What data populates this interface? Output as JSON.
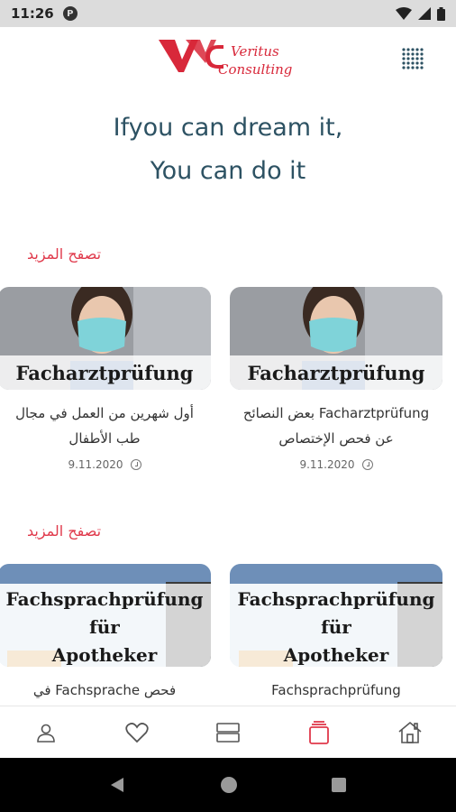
{
  "status_bar": {
    "time": "11:26",
    "app_icon_label": "P",
    "icons": [
      "wifi-icon",
      "signal-icon",
      "battery-icon"
    ]
  },
  "header": {
    "logo_text_line1": "Veritus",
    "logo_text_line2": "Consulting",
    "logo_mark": "VC",
    "menu_icon": "grid-dots-icon"
  },
  "hero": {
    "line1": "Ifyou can dream it,",
    "line2": "You can do it"
  },
  "sections": [
    {
      "more_label": "تصفح المزيد",
      "cards": [
        {
          "image_title": "Facharztprüfung",
          "text": "Facharztprüfung بعض النصائح عن فحص الإختصاص",
          "date": "9.11.2020"
        },
        {
          "image_title": "Facharztprüfung",
          "text": "أول شهرين من العمل في مجال طب الأطفال",
          "date": "9.11.2020"
        }
      ]
    },
    {
      "more_label": "تصفح المزيد",
      "cards": [
        {
          "image_title_lines": [
            "Fachsprachprüfung",
            "für",
            "Apotheker"
          ],
          "text": "Fachsprachprüfung"
        },
        {
          "image_title_lines": [
            "Fachsprachprüfung",
            "für",
            "Apotheker"
          ],
          "text": "فحص Fachsprache في"
        }
      ]
    }
  ],
  "bottom_nav": [
    {
      "icon": "home-icon",
      "active": false
    },
    {
      "icon": "clipboard-icon",
      "active": true
    },
    {
      "icon": "list-icon",
      "active": false
    },
    {
      "icon": "heart-icon",
      "active": false
    },
    {
      "icon": "profile-icon",
      "active": false
    }
  ],
  "system_nav": [
    "back-icon",
    "home-circle-icon",
    "recents-icon"
  ],
  "colors": {
    "accent": "#e0394b",
    "hero_text": "#2d5263",
    "status_bar": "#dcdcdc"
  }
}
